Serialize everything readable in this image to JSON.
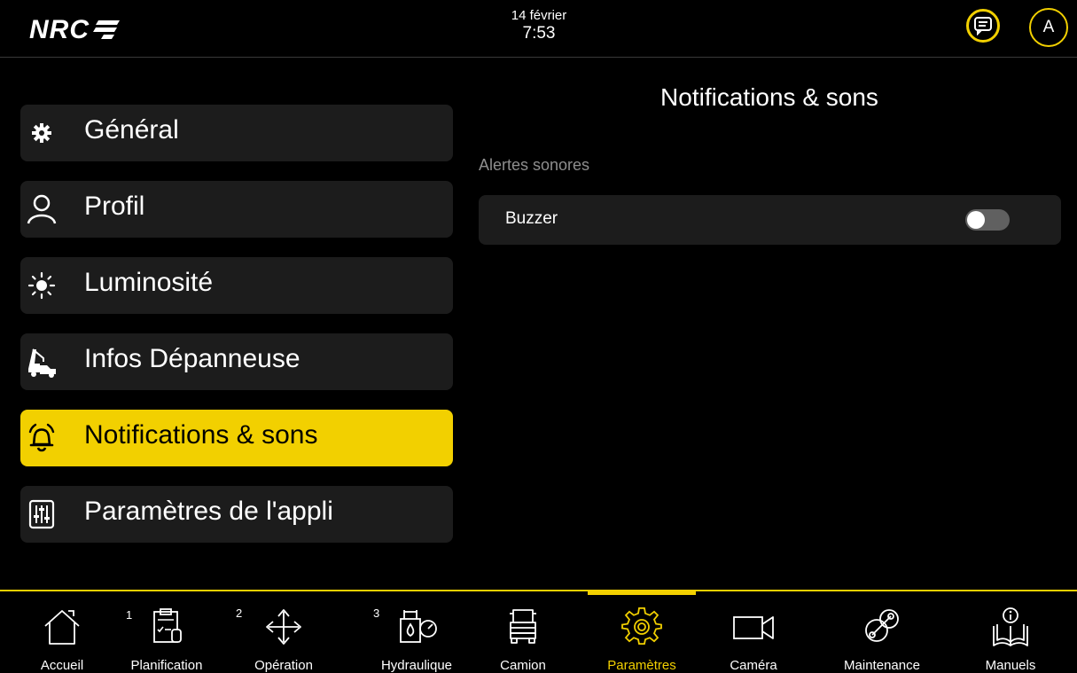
{
  "header": {
    "logo": "NRC",
    "date": "14 février",
    "time": "7:53",
    "avatar": "A"
  },
  "sidebar": {
    "items": [
      {
        "label": "Général",
        "icon": "gear-icon"
      },
      {
        "label": "Profil",
        "icon": "person-icon"
      },
      {
        "label": "Luminosité",
        "icon": "sun-icon"
      },
      {
        "label": "Infos Dépanneuse",
        "icon": "tow-truck-icon"
      },
      {
        "label": "Notifications & sons",
        "icon": "bell-icon",
        "active": true
      },
      {
        "label": "Paramètres de l'appli",
        "icon": "sliders-icon"
      }
    ]
  },
  "main": {
    "title": "Notifications & sons",
    "section": "Alertes sonores",
    "settings": [
      {
        "label": "Buzzer",
        "enabled": false
      }
    ]
  },
  "bottom_nav": {
    "items": [
      {
        "label": "Accueil",
        "icon": "home-icon"
      },
      {
        "label": "Planification",
        "icon": "clipboard-icon",
        "badge": "1"
      },
      {
        "label": "Opération",
        "icon": "move-arrows-icon",
        "badge": "2"
      },
      {
        "label": "Hydraulique",
        "icon": "hydraulic-gauge-icon",
        "badge": "3"
      },
      {
        "label": "Camion",
        "icon": "truck-icon"
      },
      {
        "label": "Paramètres",
        "icon": "settings-gear-icon",
        "active": true
      },
      {
        "label": "Caméra",
        "icon": "video-camera-icon"
      },
      {
        "label": "Maintenance",
        "icon": "wrench-gears-icon"
      },
      {
        "label": "Manuels",
        "icon": "book-info-icon"
      }
    ]
  },
  "colors": {
    "accent": "#f2d000",
    "background": "#000000",
    "card": "#1c1c1c"
  }
}
